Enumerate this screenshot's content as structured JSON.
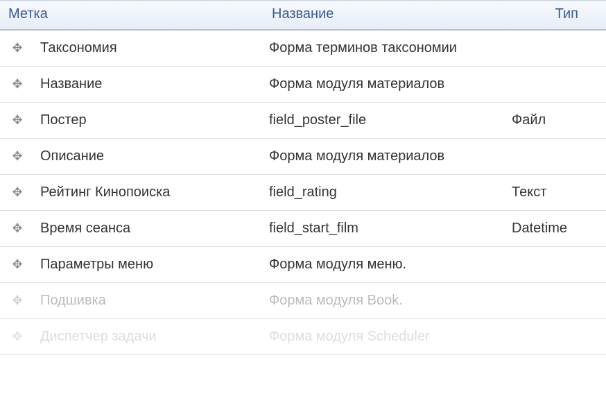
{
  "headers": {
    "label": "Метка",
    "name": "Название",
    "type": "Тип"
  },
  "rows": [
    {
      "label": "Таксономия",
      "name": "Форма терминов таксономии",
      "type": "",
      "faded": ""
    },
    {
      "label": "Название",
      "name": "Форма модуля материалов",
      "type": "",
      "faded": ""
    },
    {
      "label": "Постер",
      "name": "field_poster_file",
      "type": "Файл",
      "faded": ""
    },
    {
      "label": "Описание",
      "name": "Форма модуля материалов",
      "type": "",
      "faded": ""
    },
    {
      "label": "Рейтинг Кинопоиска",
      "name": "field_rating",
      "type": "Текст",
      "faded": ""
    },
    {
      "label": "Время сеанса",
      "name": "field_start_film",
      "type": "Datetime",
      "faded": ""
    },
    {
      "label": "Параметры меню",
      "name": "Форма модуля меню.",
      "type": "",
      "faded": ""
    },
    {
      "label": "Подшивка",
      "name": "Форма модуля Book.",
      "type": "",
      "faded": "faded"
    },
    {
      "label": "Диспетчер задачи",
      "name": "Форма модуля Scheduler",
      "type": "",
      "faded": "very-faded"
    }
  ]
}
